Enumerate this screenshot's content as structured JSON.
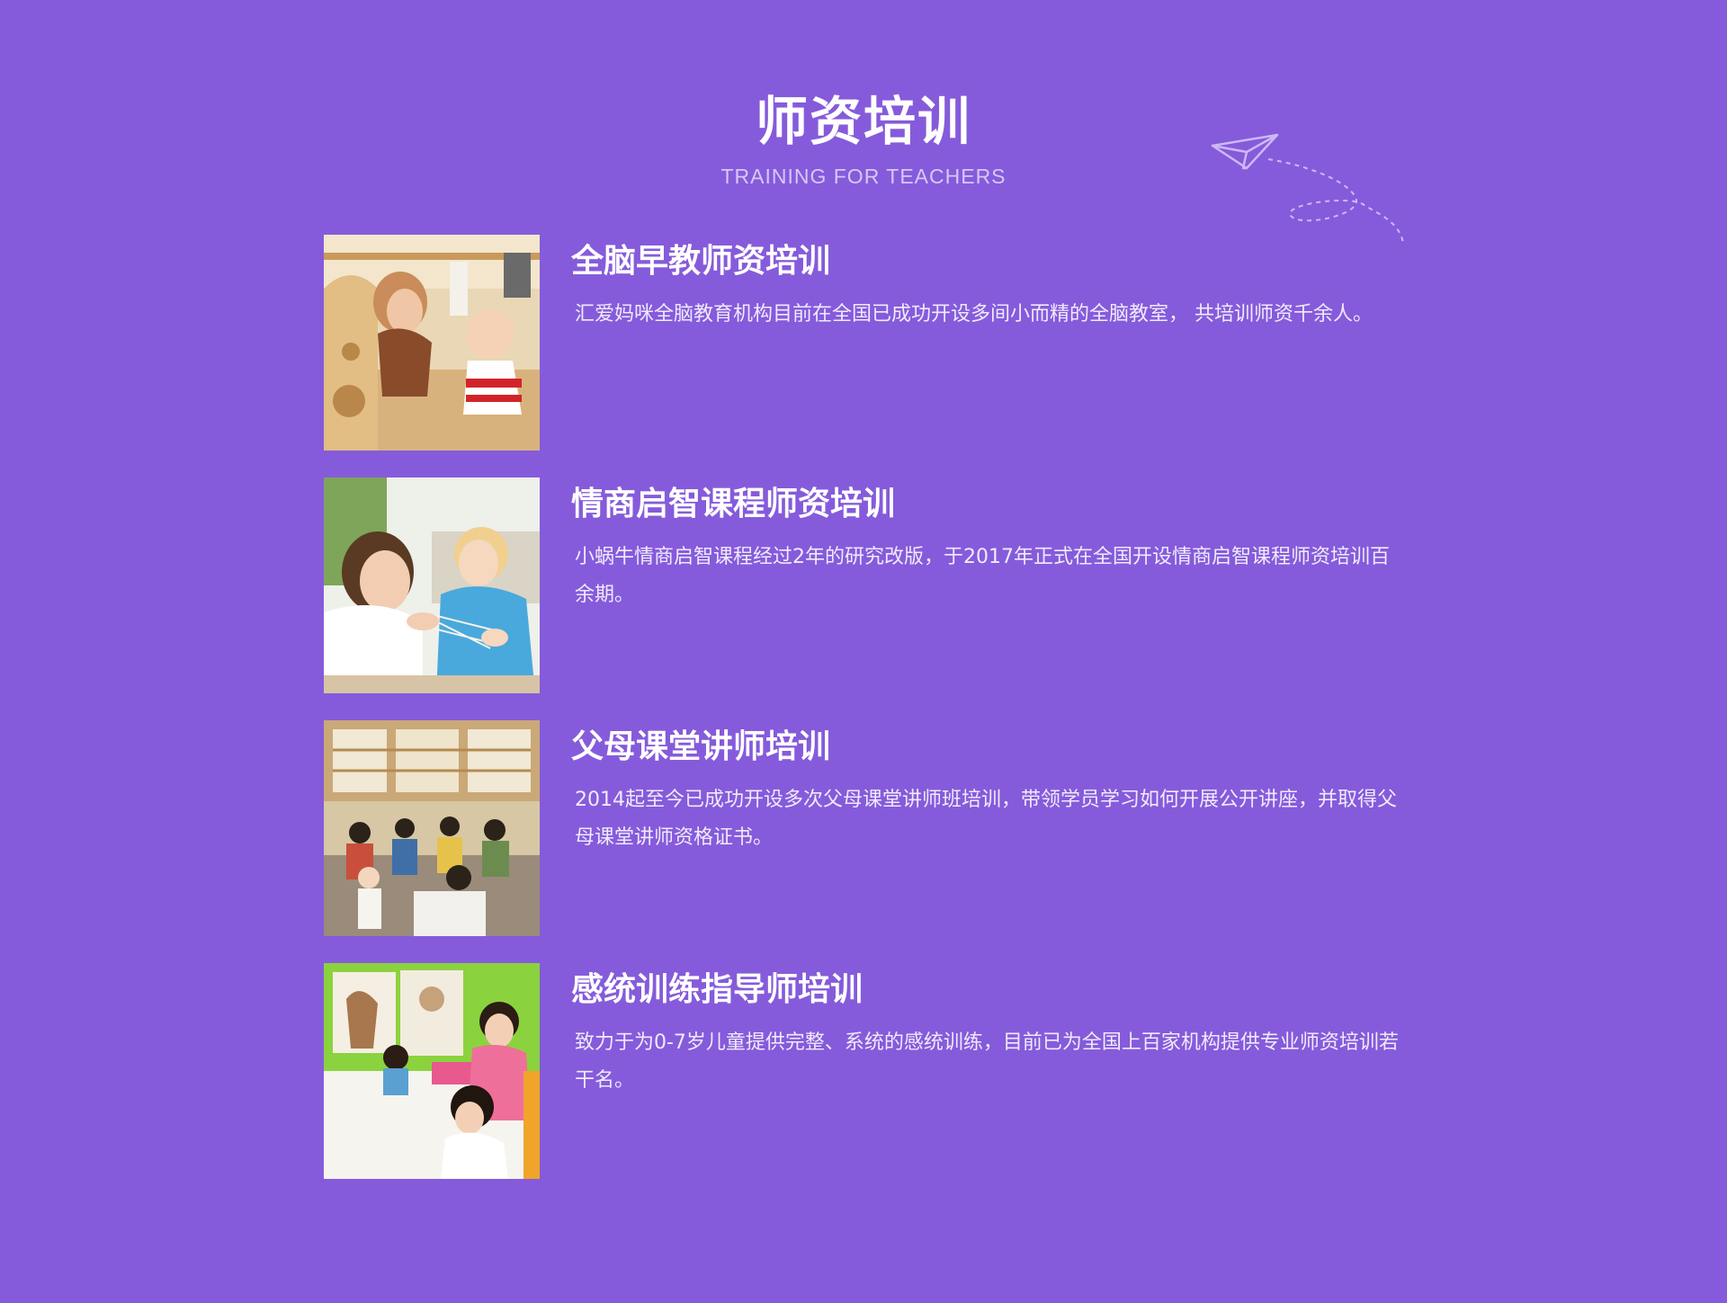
{
  "section": {
    "title": "师资培训",
    "subtitle": "TRAINING FOR TEACHERS"
  },
  "trainings": [
    {
      "title": "全脑早教师资培训",
      "description": "汇爱妈咪全脑教育机构目前在全国已成功开设多间小而精的全脑教室， 共培训师资千余人。",
      "photo": "teacher-with-baby-photo"
    },
    {
      "title": "情商启智课程师资培训",
      "description": "小蜗牛情商启智课程经过2年的研究改版，于2017年正式在全国开设情商启智课程师资培训百余期。",
      "photo": "teacher-string-game-photo"
    },
    {
      "title": "父母课堂讲师培训",
      "description": "2014起至今已成功开设多次父母课堂讲师班培训，带领学员学习如何开展公开讲座，并取得父母课堂讲师资格证书。",
      "photo": "parent-classroom-photo"
    },
    {
      "title": "感统训练指导师培训",
      "description": "致力于为0-7岁儿童提供完整、系统的感统训练，目前已为全国上百家机构提供专业师资培训若干名。",
      "photo": "children-craft-table-photo"
    }
  ],
  "colors": {
    "background": "#855bdb",
    "text": "#ffffff",
    "subtitle": "#d6c8f6"
  },
  "icons": {
    "decoration": "paper-plane-icon"
  }
}
